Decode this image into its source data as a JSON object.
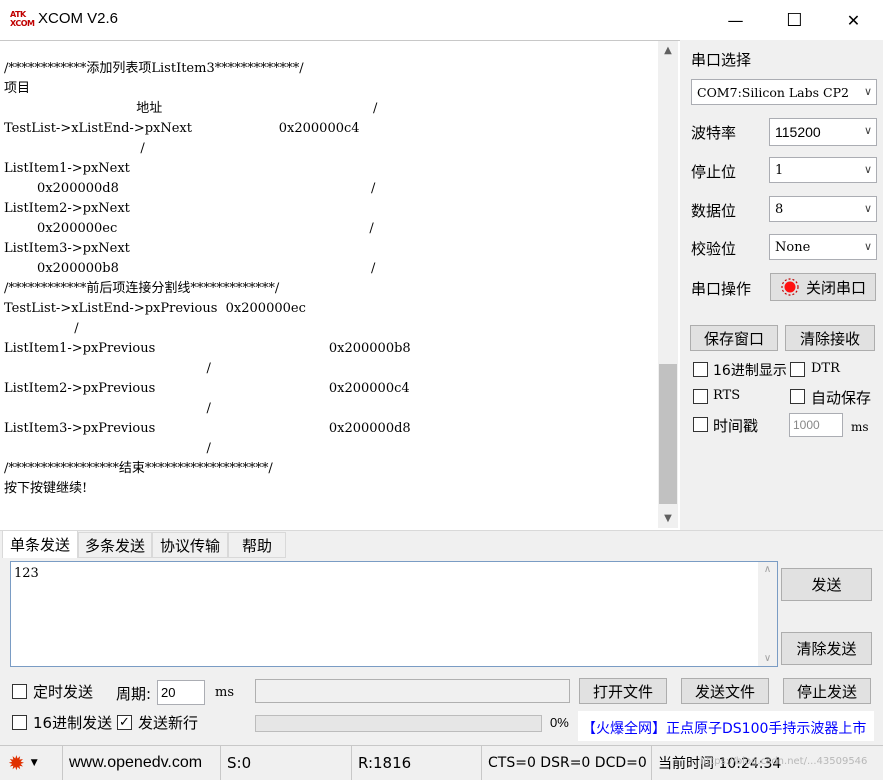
{
  "window": {
    "title": "XCOM V2.6",
    "logo_line1": "ATK",
    "logo_line2": "XCOM",
    "minimize": "—",
    "maximize": "☐",
    "close": "✕"
  },
  "receive": {
    "lines": [
      "/************添加列表项ListItem3*************/",
      "项目",
      "                                地址                                                   /",
      "TestList->xListEnd->pxNext                     0x200000c4",
      "                                 /",
      "ListItem1->pxNext",
      "        0x200000d8                                                             /",
      "ListItem2->pxNext",
      "        0x200000ec                                                             /",
      "ListItem3->pxNext",
      "        0x200000b8                                                             /",
      "/************前后项连接分割线*************/",
      "TestList->xListEnd->pxPrevious  0x200000ec",
      "                 /",
      "ListItem1->pxPrevious                                          0x200000b8",
      "                                                 /",
      "ListItem2->pxPrevious                                          0x200000c4",
      "                                                 /",
      "ListItem3->pxPrevious                                          0x200000d8",
      "                                                 /",
      "/*****************结束*******************/",
      "按下按键继续!"
    ]
  },
  "serial": {
    "port_label": "串口选择",
    "port_value": "COM7:Silicon Labs CP2",
    "baud_label": "波特率",
    "baud_value": "115200",
    "stop_label": "停止位",
    "stop_value": "1",
    "data_label": "数据位",
    "data_value": "8",
    "parity_label": "校验位",
    "parity_value": "None",
    "op_label": "串口操作",
    "op_button": "关闭串口",
    "save_window": "保存窗口",
    "clear_receive": "清除接收",
    "hex_display": "16进制显示",
    "dtr": "DTR",
    "rts": "RTS",
    "auto_save": "自动保存",
    "timestamp": "时间戳",
    "timestamp_value": "1000",
    "ms": "ms"
  },
  "tabs": [
    "单条发送",
    "多条发送",
    "协议传输",
    "帮助"
  ],
  "send": {
    "text": "123",
    "send_button": "发送",
    "clear_send": "清除发送",
    "timed_send": "定时发送",
    "period_label": "周期:",
    "period_value": "20",
    "ms": "ms",
    "open_file": "打开文件",
    "send_file": "发送文件",
    "stop_send": "停止发送",
    "hex_send": "16进制发送",
    "send_newline": "发送新行",
    "progress": "0%",
    "ad": "【火爆全网】正点原子DS100手持示波器上市"
  },
  "status": {
    "url": "www.openedv.com",
    "sent": "S:0",
    "received": "R:1816",
    "signals": "CTS=0 DSR=0 DCD=0",
    "time": "当前时间 10:24:34",
    "watermark": "https://blog.csdn.net/...43509546"
  },
  "colors": {
    "accent_red": "#c00000",
    "ad_blue": "#0000ff",
    "link_blue": "#0000c0"
  }
}
